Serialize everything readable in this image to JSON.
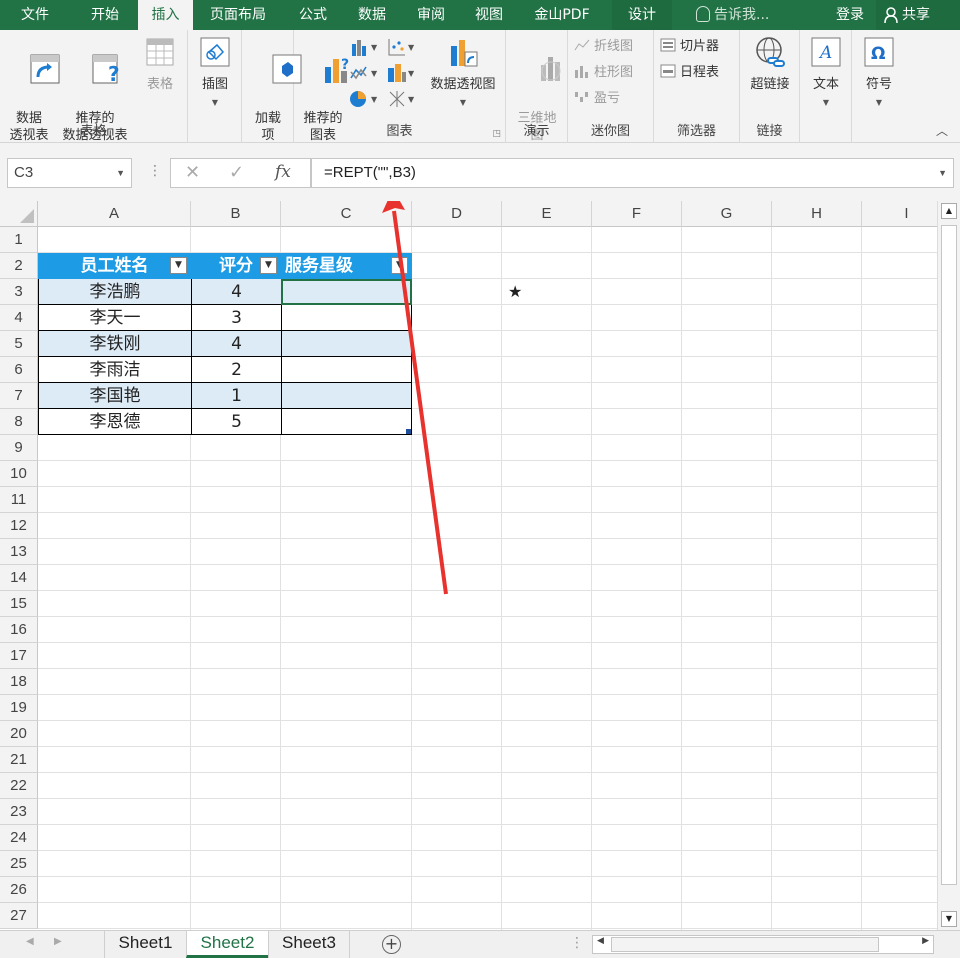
{
  "tabs": [
    "文件",
    "开始",
    "插入",
    "页面布局",
    "公式",
    "数据",
    "审阅",
    "视图",
    "金山PDF",
    "设计"
  ],
  "tell_me": "告诉我...",
  "login": "登录",
  "share": "共享",
  "ribbon": {
    "pivot": "数据\n透视表",
    "recommended_pivot": "推荐的\n数据透视表",
    "table": "表格",
    "group_tables": "表格",
    "illustrations": "插图",
    "addins": "加载\n项",
    "recommended_charts": "推荐的\n图表",
    "pivot_chart": "数据透视图",
    "group_charts": "图表",
    "map3d": "三维地\n图",
    "group_tours": "演示",
    "spark_line": "折线图",
    "spark_column": "柱形图",
    "spark_winloss": "盈亏",
    "group_sparklines": "迷你图",
    "slicer": "切片器",
    "timeline": "日程表",
    "group_filters": "筛选器",
    "hyperlink": "超链接",
    "group_links": "链接",
    "text": "文本",
    "symbols": "符号"
  },
  "formula_bar": {
    "name_box": "C3",
    "formula": "=REPT(\"\",B3)"
  },
  "columns": [
    "A",
    "B",
    "C",
    "D",
    "E",
    "F",
    "G",
    "H",
    "I"
  ],
  "rows": [
    "1",
    "2",
    "3",
    "4",
    "5",
    "6",
    "7",
    "8",
    "9",
    "10",
    "11",
    "12",
    "13",
    "14",
    "15",
    "16",
    "17",
    "18",
    "19",
    "20",
    "21",
    "22",
    "23",
    "24",
    "25",
    "26",
    "27"
  ],
  "table": {
    "headers": [
      "员工姓名",
      "评分",
      "服务星级"
    ],
    "data": [
      [
        "李浩鹏",
        "4"
      ],
      [
        "李天一",
        "3"
      ],
      [
        "李铁刚",
        "4"
      ],
      [
        "李雨洁",
        "2"
      ],
      [
        "李国艳",
        "1"
      ],
      [
        "李恩德",
        "5"
      ]
    ]
  },
  "cell_E3": "★",
  "sheets": [
    "Sheet1",
    "Sheet2",
    "Sheet3"
  ],
  "active_sheet": "Sheet2",
  "colors": {
    "ribbon_green": "#217346",
    "table_header": "#1e9be5",
    "band": "#ddebf7",
    "arrow": "#e8322d"
  }
}
